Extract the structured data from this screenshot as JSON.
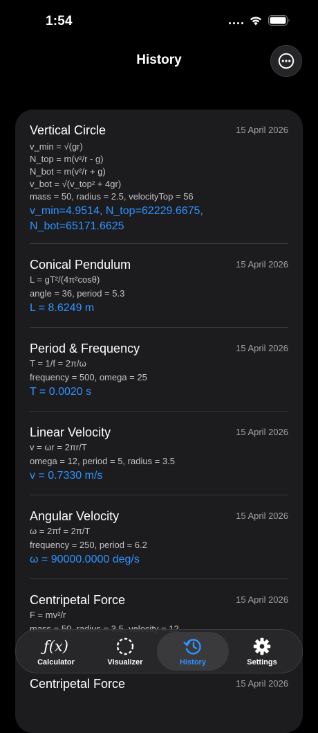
{
  "status": {
    "time": "1:54"
  },
  "nav": {
    "title": "History"
  },
  "history": [
    {
      "title": "Vertical Circle",
      "date": "15 April 2026",
      "lines": [
        "v_min = √(gr)",
        "N_top = m(v²/r - g)",
        "N_bot = m(v²/r + g)",
        "v_bot = √(v_top² + 4gr)",
        "mass = 50, radius = 2.5, velocityTop = 56"
      ],
      "result": [
        "v_min=4.9514, N_top=62229.6675,",
        "N_bot=65171.6625"
      ]
    },
    {
      "title": "Conical Pendulum",
      "date": "15 April 2026",
      "lines": [
        "L = gT²/(4π²cosθ)",
        "angle = 36, period = 5.3"
      ],
      "result": [
        "L = 8.6249 m"
      ]
    },
    {
      "title": "Period & Frequency",
      "date": "15 April 2026",
      "lines": [
        "T = 1/f = 2π/ω",
        "frequency = 500, omega = 25"
      ],
      "result": [
        "T = 0.0020 s"
      ]
    },
    {
      "title": "Linear Velocity",
      "date": "15 April 2026",
      "lines": [
        "v = ωr = 2πr/T",
        "omega = 12, period = 5, radius = 3.5"
      ],
      "result": [
        "v = 0.7330 m/s"
      ]
    },
    {
      "title": "Angular Velocity",
      "date": "15 April 2026",
      "lines": [
        "ω = 2πf = 2π/T",
        "frequency = 250, period = 6.2"
      ],
      "result": [
        "ω = 90000.0000 deg/s"
      ]
    },
    {
      "title": "Centripetal Force",
      "date": "15 April 2026",
      "lines": [
        "F = mv²/r",
        "mass = 50, radius = 3.5, velocity = 12"
      ],
      "result": []
    },
    {
      "title": "Centripetal Force",
      "date": "15 April 2026",
      "lines": [],
      "result": []
    }
  ],
  "tabs": [
    {
      "label": "Calculator",
      "icon": "function-icon"
    },
    {
      "label": "Visualizer",
      "icon": "dashed-circle-icon"
    },
    {
      "label": "History",
      "icon": "clock-history-icon"
    },
    {
      "label": "Settings",
      "icon": "gear-icon"
    }
  ],
  "colors": {
    "accent": "#2f93ff",
    "card": "#1c1c1e",
    "background": "#000000"
  }
}
